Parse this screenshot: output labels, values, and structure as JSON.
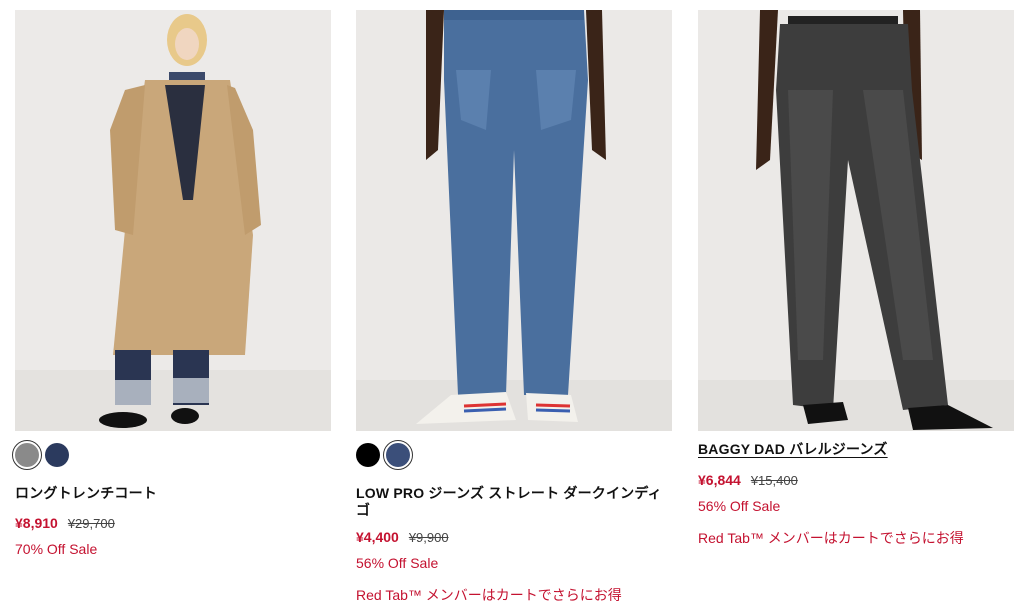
{
  "products": [
    {
      "title": "ロングトレンチコート",
      "price": "¥8,910",
      "original_price": "¥29,700",
      "sale": "70% Off Sale",
      "swatches": [
        {
          "color": "#8a8a8a",
          "selected": true
        },
        {
          "color": "#2b3a5e",
          "selected": false
        }
      ]
    },
    {
      "title": "LOW PRO ジーンズ ストレート ダークインディゴ",
      "price": "¥4,400",
      "original_price": "¥9,900",
      "sale": "56% Off Sale",
      "promo": "Red Tab™ メンバーはカートでさらにお得",
      "swatches": [
        {
          "color": "#000000",
          "selected": false
        },
        {
          "color": "#3b4f7a",
          "selected": true
        }
      ]
    },
    {
      "title": "BAGGY DAD バレルジーンズ",
      "price": "¥6,844",
      "original_price": "¥15,400",
      "sale": "56% Off Sale",
      "promo": "Red Tab™ メンバーはカートでさらにお得"
    }
  ],
  "colors": {
    "sale_red": "#c41230",
    "image_bg": "#ebe9e7"
  }
}
